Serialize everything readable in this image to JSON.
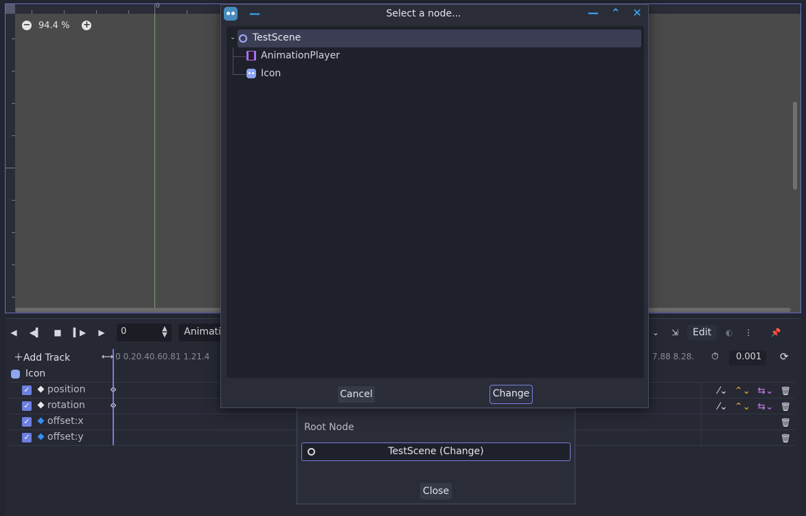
{
  "viewport": {
    "ruler_zero": "0",
    "zoom_value": "94.4 %",
    "zoom_out_icon": "minus-icon",
    "zoom_in_icon": "plus-icon"
  },
  "animation_panel": {
    "time_value": "0",
    "animation_select": "Animati",
    "edit_label": "Edit",
    "add_track_label": "Add Track",
    "time_labels_left": "0  0.20.40.60.81  1.21.4",
    "time_labels_right": "7.88  8.28.",
    "snap_value": "0.001",
    "node_name": "Icon",
    "tracks": [
      {
        "label": "position",
        "diamond_color": "#e8e8e8"
      },
      {
        "label": "rotation",
        "diamond_color": "#e8e8e8"
      },
      {
        "label": "offset:x",
        "diamond_color": "#3a8cf0"
      },
      {
        "label": "offset:y",
        "diamond_color": "#3a8cf0"
      }
    ]
  },
  "select_node_dialog": {
    "title": "Select a node...",
    "tree": {
      "root": "TestScene",
      "children": [
        "AnimationPlayer",
        "Icon"
      ]
    },
    "cancel_label": "Cancel",
    "change_label": "Change"
  },
  "root_node_dialog": {
    "root_node_label": "Root Node",
    "root_button_label": "TestScene (Change)",
    "close_label": "Close"
  },
  "colors": {
    "accent": "#7a80e0",
    "title_controls": "#3ab0ff"
  }
}
